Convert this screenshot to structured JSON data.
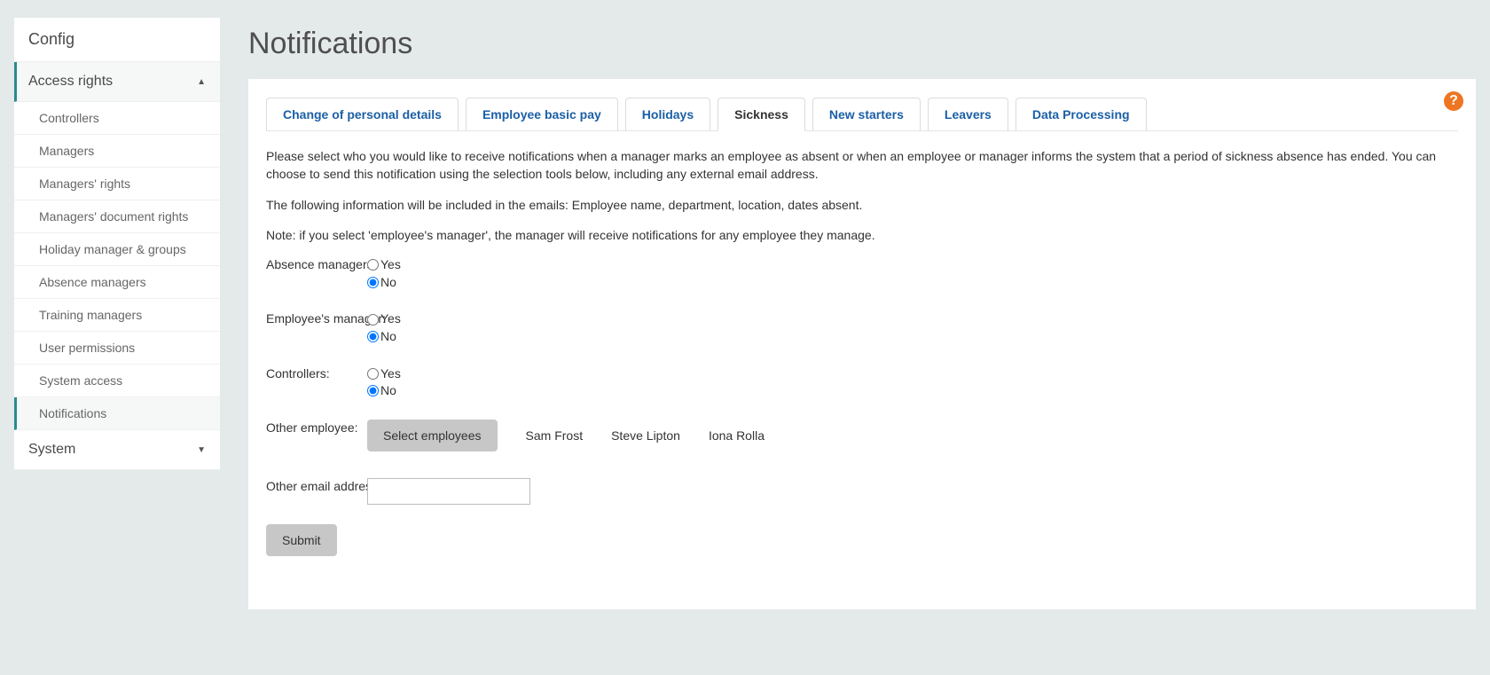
{
  "sidebar": {
    "config_label": "Config",
    "access_label": "Access rights",
    "system_label": "System",
    "items": [
      {
        "label": "Controllers"
      },
      {
        "label": "Managers"
      },
      {
        "label": "Managers' rights"
      },
      {
        "label": "Managers' document rights"
      },
      {
        "label": "Holiday manager & groups"
      },
      {
        "label": "Absence managers"
      },
      {
        "label": "Training managers"
      },
      {
        "label": "User permissions"
      },
      {
        "label": "System access"
      },
      {
        "label": "Notifications"
      }
    ]
  },
  "page": {
    "title": "Notifications"
  },
  "tabs": [
    {
      "label": "Change of personal details"
    },
    {
      "label": "Employee basic pay"
    },
    {
      "label": "Holidays"
    },
    {
      "label": "Sickness"
    },
    {
      "label": "New starters"
    },
    {
      "label": "Leavers"
    },
    {
      "label": "Data Processing"
    }
  ],
  "content": {
    "p1": "Please select who you would like to receive notifications when a manager marks an employee as absent or when an employee or manager informs the system that a period of sickness absence has ended. You can choose to send this notification using the selection tools below, including any external email address.",
    "p2": "The following information will be included in the emails: Employee name, department, location, dates absent.",
    "p3": "Note: if you select 'employee's manager', the manager will receive notifications for any employee they manage."
  },
  "form": {
    "absence_label": "Absence managers:",
    "employees_mgr_label": "Employee's manager:",
    "controllers_label": "Controllers:",
    "other_emp_label": "Other employee:",
    "other_email_label": "Other email address:",
    "yes": "Yes",
    "no": "No",
    "select_btn": "Select employees",
    "submit": "Submit",
    "emp1": "Sam Frost",
    "emp2": "Steve Lipton",
    "emp3": "Iona Rolla"
  }
}
